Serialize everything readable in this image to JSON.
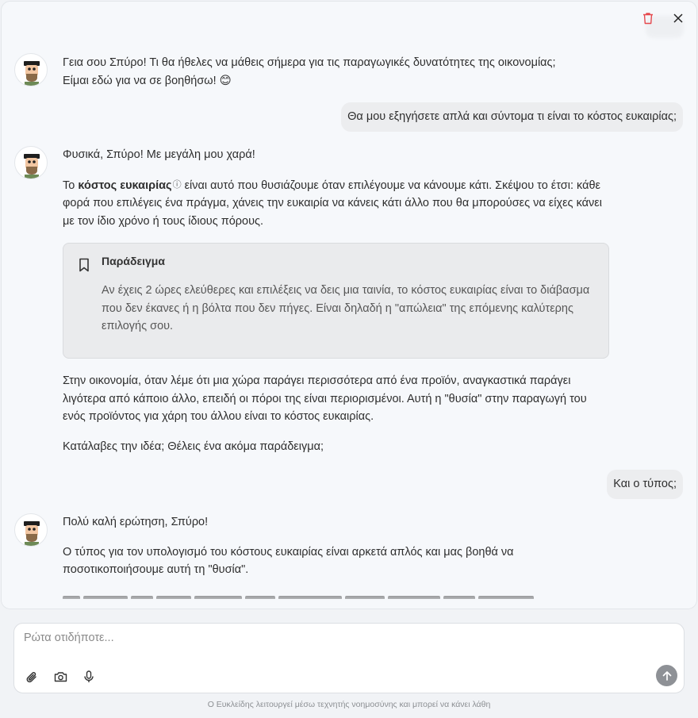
{
  "messages": {
    "greeting_line1": "Γεια σου Σπύρο! Τι θα ήθελες να μάθεις σήμερα για τις παραγωγικές δυνατότητες της οικονομίας;",
    "greeting_line2": "Είμαι εδώ για να σε βοηθήσω! 😊",
    "user_q1": "Θα μου εξηγήσετε απλά και σύντομα τι είναι το κόστος ευκαιρίας;",
    "answer1_intro": "Φυσικά, Σπύρο! Με μεγάλη μου χαρά!",
    "answer1_p1_prefix": "Το ",
    "answer1_p1_term": "κόστος ευκαιρίας",
    "answer1_p1_info": "ⓘ",
    "answer1_p1_rest": " είναι αυτό που θυσιάζουμε όταν επιλέγουμε να κάνουμε κάτι. Σκέψου το έτσι: κάθε φορά που επιλέγεις ένα πράγμα, χάνεις την ευκαιρία να κάνεις κάτι άλλο που θα μπορούσες να είχες κάνει με τον ίδιο χρόνο ή τους ίδιους πόρους.",
    "example_title": "Παράδειγμα",
    "example_body": "Αν έχεις 2 ώρες ελεύθερες και επιλέξεις να δεις μια ταινία, το κόστος ευκαιρίας είναι το διάβασμα που δεν έκανες ή η βόλτα που δεν πήγες. Είναι δηλαδή η \"απώλεια\" της επόμενης καλύτερης επιλογής σου.",
    "answer1_p2": "Στην οικονομία, όταν λέμε ότι μια χώρα παράγει περισσότερα από ένα προϊόν, αναγκαστικά παράγει λιγότερα από κάποιο άλλο, επειδή οι πόροι της είναι περιορισμένοι. Αυτή η \"θυσία\" στην παραγωγή του ενός προϊόντος για χάρη του άλλου είναι το κόστος ευκαιρίας.",
    "answer1_p3": "Κατάλαβες την ιδέα; Θέλεις ένα ακόμα παράδειγμα;",
    "user_q2": "Και ο τύπος;",
    "answer2_p1": "Πολύ καλή ερώτηση, Σπύρο!",
    "answer2_p2": "Ο τύπος για τον υπολογισμό του κόστους ευκαιρίας είναι αρκετά απλός και μας βοηθά να ποσοτικοποιήσουμε αυτή τη \"θυσία\"."
  },
  "composer": {
    "placeholder": "Ρώτα οτιδήποτε..."
  },
  "icons": {
    "delete": "trash-icon",
    "close": "close-icon",
    "attach": "paperclip-icon",
    "camera": "camera-icon",
    "mic": "microphone-icon",
    "send": "arrow-up-icon",
    "bookmark": "bookmark-icon"
  },
  "colors": {
    "delete_red": "#e5484d",
    "send_bg": "#8e9196"
  },
  "footer": {
    "disclaimer": "Ο Ευκλείδης λειτουργεί μέσω τεχνητής νοημοσύνης και μπορεί να κάνει λάθη"
  }
}
